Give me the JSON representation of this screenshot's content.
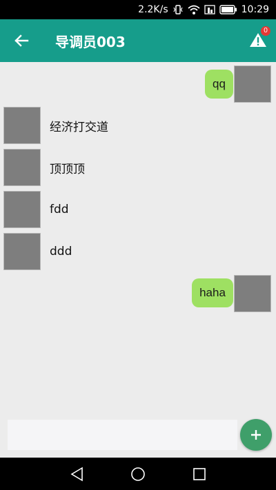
{
  "status_bar": {
    "speed": "2.2K/s",
    "time": "10:29"
  },
  "header": {
    "title": "导调员003",
    "alert_badge": "0",
    "colors": {
      "bar": "#169d8b",
      "badge": "#e53935"
    }
  },
  "messages": [
    {
      "side": "right",
      "text": "qq"
    },
    {
      "side": "left",
      "text": "经济打交道"
    },
    {
      "side": "left",
      "text": "顶顶顶"
    },
    {
      "side": "left",
      "text": "fdd"
    },
    {
      "side": "left",
      "text": "ddd"
    },
    {
      "side": "right",
      "text": "haha"
    }
  ],
  "composer": {
    "placeholder": "",
    "add_icon": "plus-icon",
    "add_color": "#3f9f6a"
  },
  "icons": {
    "back": "arrow-left-icon",
    "alert": "warning-icon",
    "nav": [
      "back-triangle-icon",
      "home-circle-icon",
      "recents-square-icon"
    ]
  }
}
